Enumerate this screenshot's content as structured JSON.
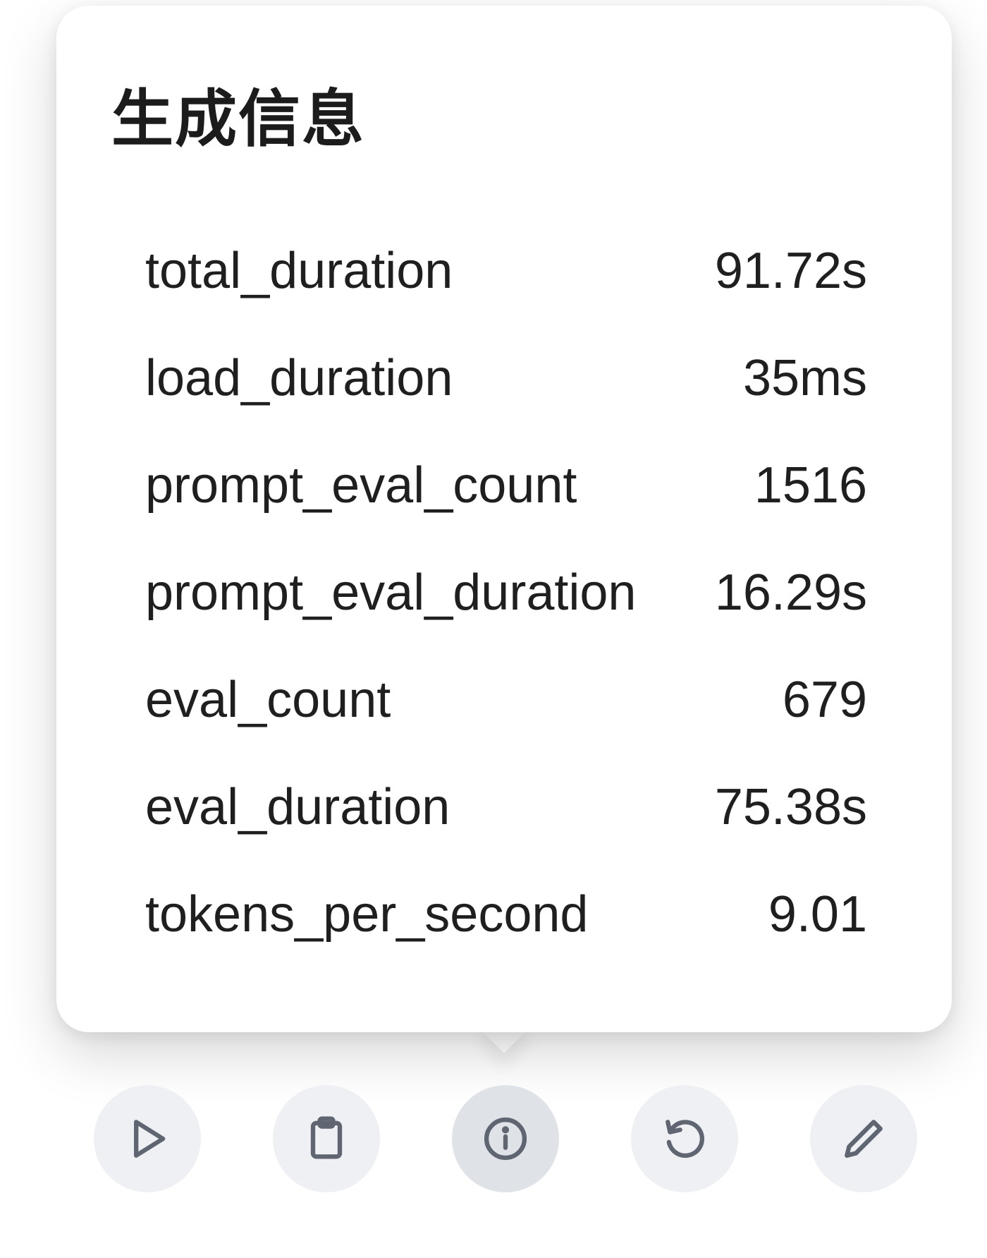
{
  "popover": {
    "title": "生成信息",
    "stats": [
      {
        "key": "total_duration",
        "value": "91.72s"
      },
      {
        "key": "load_duration",
        "value": "35ms"
      },
      {
        "key": "prompt_eval_count",
        "value": "1516"
      },
      {
        "key": "prompt_eval_duration",
        "value": "16.29s"
      },
      {
        "key": "eval_count",
        "value": "679"
      },
      {
        "key": "eval_duration",
        "value": "75.38s"
      },
      {
        "key": "tokens_per_second",
        "value": "9.01"
      }
    ]
  },
  "toolbar": {
    "buttons": [
      {
        "icon": "play-icon"
      },
      {
        "icon": "clipboard-icon"
      },
      {
        "icon": "info-icon",
        "active": true
      },
      {
        "icon": "regenerate-icon"
      },
      {
        "icon": "pencil-icon"
      }
    ]
  },
  "colors": {
    "icon": "#5f6672",
    "button_bg": "#eef0f3",
    "button_active_bg": "#dfe2e7",
    "text": "#1f1f1f"
  }
}
